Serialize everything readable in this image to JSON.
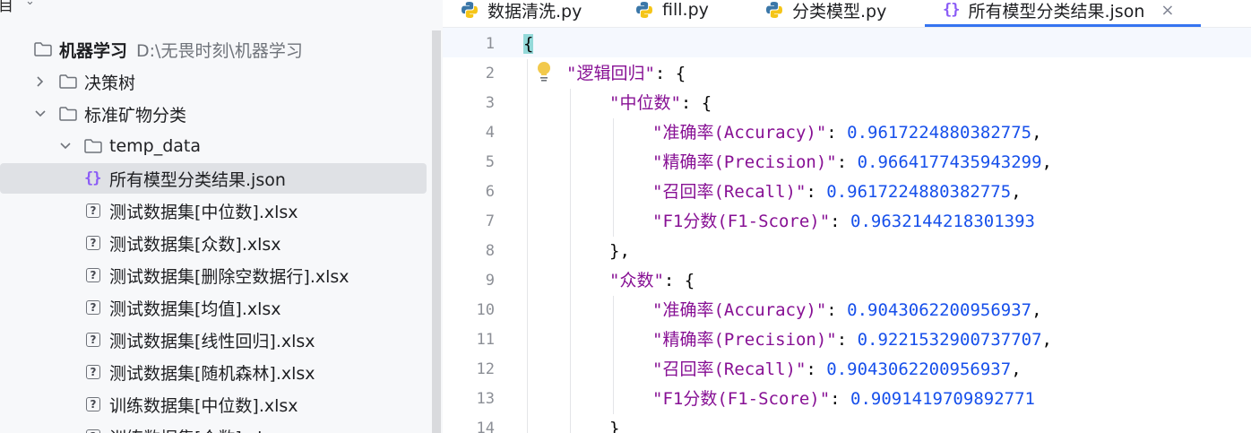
{
  "sidebar": {
    "header_title": "目",
    "tree": [
      {
        "label": "机器学习",
        "path": "D:\\无畏时刻\\机器学习",
        "type": "folder",
        "expanded": true,
        "level": 0
      },
      {
        "label": "决策树",
        "type": "folder",
        "expanded": false,
        "level": 1
      },
      {
        "label": "标准矿物分类",
        "type": "folder",
        "expanded": true,
        "level": 1
      },
      {
        "label": "temp_data",
        "type": "folder",
        "expanded": true,
        "level": 2
      },
      {
        "label": "所有模型分类结果.json",
        "type": "json",
        "level": 3,
        "selected": true
      },
      {
        "label": "测试数据集[中位数].xlsx",
        "type": "unknown",
        "level": 3
      },
      {
        "label": "测试数据集[众数].xlsx",
        "type": "unknown",
        "level": 3
      },
      {
        "label": "测试数据集[删除空数据行].xlsx",
        "type": "unknown",
        "level": 3
      },
      {
        "label": "测试数据集[均值].xlsx",
        "type": "unknown",
        "level": 3
      },
      {
        "label": "测试数据集[线性回归].xlsx",
        "type": "unknown",
        "level": 3
      },
      {
        "label": "测试数据集[随机森林].xlsx",
        "type": "unknown",
        "level": 3
      },
      {
        "label": "训练数据集[中位数].xlsx",
        "type": "unknown",
        "level": 3
      },
      {
        "label": "训练数据集[众数].xlsx",
        "type": "unknown",
        "level": 3
      }
    ]
  },
  "tabs": [
    {
      "label": "数据清洗.py",
      "icon": "python-icon"
    },
    {
      "label": "fill.py",
      "icon": "python-icon"
    },
    {
      "label": "分类模型.py",
      "icon": "python-icon"
    },
    {
      "label": "所有模型分类结果.json",
      "icon": "json-icon",
      "active": true,
      "close": "×"
    }
  ],
  "editor": {
    "json_icon_glyph": "{}",
    "lines": [
      {
        "n": "1",
        "indent": 0,
        "parts": [
          {
            "t": "{",
            "c": "punct"
          }
        ]
      },
      {
        "n": "2",
        "indent": 1,
        "parts": [
          {
            "t": "\"逻辑回归\"",
            "c": "str"
          },
          {
            "t": ": {",
            "c": "punct"
          }
        ]
      },
      {
        "n": "3",
        "indent": 2,
        "parts": [
          {
            "t": "\"中位数\"",
            "c": "str"
          },
          {
            "t": ": {",
            "c": "punct"
          }
        ]
      },
      {
        "n": "4",
        "indent": 3,
        "parts": [
          {
            "t": "\"准确率(Accuracy)\"",
            "c": "str"
          },
          {
            "t": ": ",
            "c": "punct"
          },
          {
            "t": "0.9617224880382775",
            "c": "num"
          },
          {
            "t": ",",
            "c": "punct"
          }
        ]
      },
      {
        "n": "5",
        "indent": 3,
        "parts": [
          {
            "t": "\"精确率(Precision)\"",
            "c": "str"
          },
          {
            "t": ": ",
            "c": "punct"
          },
          {
            "t": "0.9664177435943299",
            "c": "num"
          },
          {
            "t": ",",
            "c": "punct"
          }
        ]
      },
      {
        "n": "6",
        "indent": 3,
        "parts": [
          {
            "t": "\"召回率(Recall)\"",
            "c": "str"
          },
          {
            "t": ": ",
            "c": "punct"
          },
          {
            "t": "0.9617224880382775",
            "c": "num"
          },
          {
            "t": ",",
            "c": "punct"
          }
        ]
      },
      {
        "n": "7",
        "indent": 3,
        "parts": [
          {
            "t": "\"F1分数(F1-Score)\"",
            "c": "str"
          },
          {
            "t": ": ",
            "c": "punct"
          },
          {
            "t": "0.9632144218301393",
            "c": "num"
          }
        ]
      },
      {
        "n": "8",
        "indent": 2,
        "parts": [
          {
            "t": "},",
            "c": "punct"
          }
        ]
      },
      {
        "n": "9",
        "indent": 2,
        "parts": [
          {
            "t": "\"众数\"",
            "c": "str"
          },
          {
            "t": ": {",
            "c": "punct"
          }
        ]
      },
      {
        "n": "10",
        "indent": 3,
        "parts": [
          {
            "t": "\"准确率(Accuracy)\"",
            "c": "str"
          },
          {
            "t": ": ",
            "c": "punct"
          },
          {
            "t": "0.9043062200956937",
            "c": "num"
          },
          {
            "t": ",",
            "c": "punct"
          }
        ]
      },
      {
        "n": "11",
        "indent": 3,
        "parts": [
          {
            "t": "\"精确率(Precision)\"",
            "c": "str"
          },
          {
            "t": ": ",
            "c": "punct"
          },
          {
            "t": "0.9221532900737707",
            "c": "num"
          },
          {
            "t": ",",
            "c": "punct"
          }
        ]
      },
      {
        "n": "12",
        "indent": 3,
        "parts": [
          {
            "t": "\"召回率(Recall)\"",
            "c": "str"
          },
          {
            "t": ": ",
            "c": "punct"
          },
          {
            "t": "0.9043062200956937",
            "c": "num"
          },
          {
            "t": ",",
            "c": "punct"
          }
        ]
      },
      {
        "n": "13",
        "indent": 3,
        "parts": [
          {
            "t": "\"F1分数(F1-Score)\"",
            "c": "str"
          },
          {
            "t": ": ",
            "c": "punct"
          },
          {
            "t": "0.9091419709892771",
            "c": "num"
          }
        ]
      },
      {
        "n": "14",
        "indent": 2,
        "parts": [
          {
            "t": "}",
            "c": "punct"
          }
        ]
      }
    ]
  },
  "colors": {
    "string": "#871094",
    "number": "#1750eb",
    "accent": "#3574f0",
    "json_icon": "#8b5cf6"
  }
}
